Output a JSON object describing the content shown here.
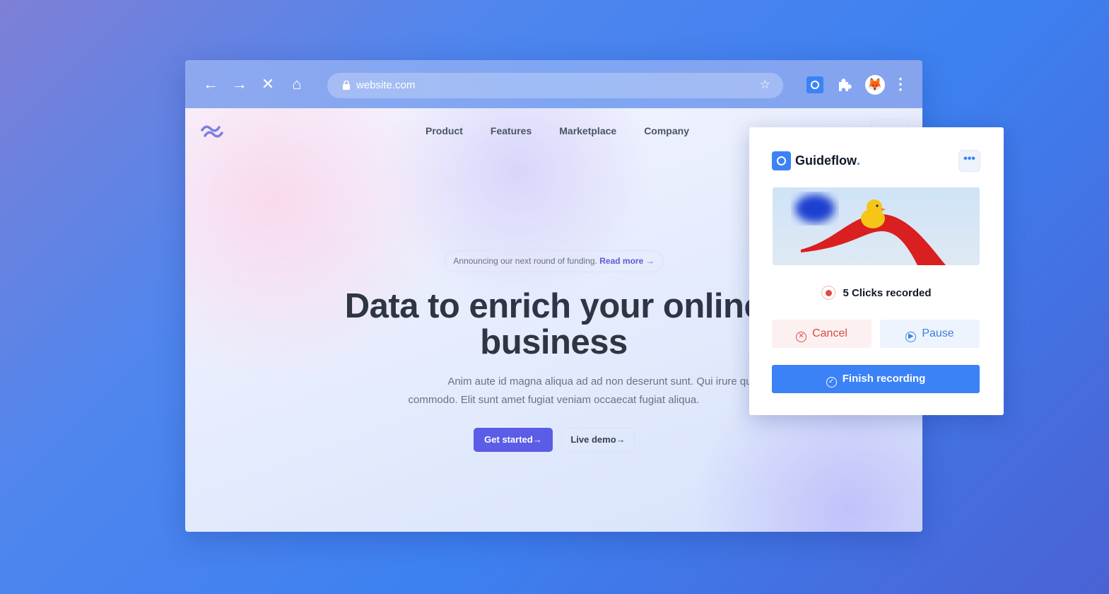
{
  "browser": {
    "url": "website.com",
    "icons": [
      "arrow-left-icon",
      "arrow-right-icon",
      "close-icon",
      "home-icon",
      "lock-icon",
      "star-icon",
      "guideflow-extension-icon",
      "puzzle-icon",
      "fox-avatar",
      "kebab-menu-icon"
    ]
  },
  "site": {
    "nav": [
      "Product",
      "Features",
      "Marketplace",
      "Company"
    ],
    "announcement": "Announcing our next round of funding.",
    "read_more": "Read more →",
    "headline_line1": "Data to enrich your online",
    "headline_line2": "business",
    "subtitle_line1": "Anim aute id magna aliqua ad ad non deserunt sunt. Qui irure qui lorem cupidatat",
    "subtitle_line2": "commodo. Elit sunt amet fugiat veniam occaecat fugiat aliqua.",
    "get_started": "Get started→",
    "live_demo": "Live demo→"
  },
  "panel": {
    "brand": "Guideflow",
    "brand_dot": ".",
    "more": "•••",
    "status": "5 Clicks recorded",
    "cancel": "Cancel",
    "pause": "Pause",
    "finish": "Finish recording"
  },
  "colors": {
    "accent": "#3b82f6",
    "cancel": "#d94a4a",
    "site_primary": "#5b5de6"
  }
}
